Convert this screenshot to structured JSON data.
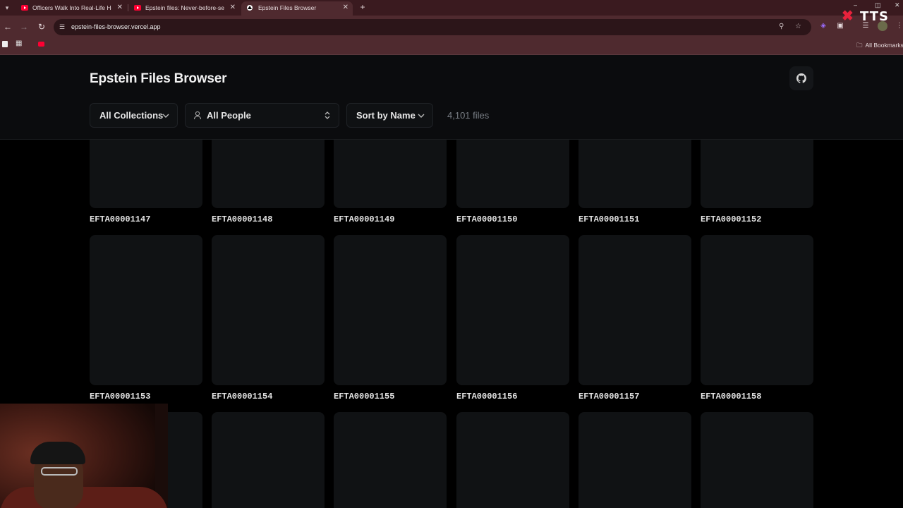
{
  "browser": {
    "tabs": [
      {
        "title": "Officers Walk Into Real-Life Ho",
        "favicon": "youtube-icon",
        "active": false
      },
      {
        "title": "Epstein files: Never-before-see",
        "favicon": "youtube-icon",
        "active": false
      },
      {
        "title": "Epstein Files Browser",
        "favicon": "vercel-icon",
        "active": true
      }
    ],
    "url": "epstein-files-browser.vercel.app",
    "bookmarks_all": "All Bookmarks",
    "overlay_logo": "TTS"
  },
  "page": {
    "title": "Epstein Files Browser",
    "filters": {
      "collections": "All Collections",
      "people": "All People",
      "sort": "Sort by Name"
    },
    "file_count": "4,101 files"
  },
  "files": {
    "row1": [
      "EFTA00001147",
      "EFTA00001148",
      "EFTA00001149",
      "EFTA00001150",
      "EFTA00001151",
      "EFTA00001152"
    ],
    "row2": [
      "EFTA00001153",
      "EFTA00001154",
      "EFTA00001155",
      "EFTA00001156",
      "EFTA00001157",
      "EFTA00001158"
    ]
  },
  "colors": {
    "chrome_tabstrip": "#3a1a1f",
    "chrome_toolbar": "#4f2a2f",
    "page_background": "#000000",
    "header_background": "#0b0c0e",
    "card_background": "#101214",
    "youtube_red": "#ff0033"
  }
}
